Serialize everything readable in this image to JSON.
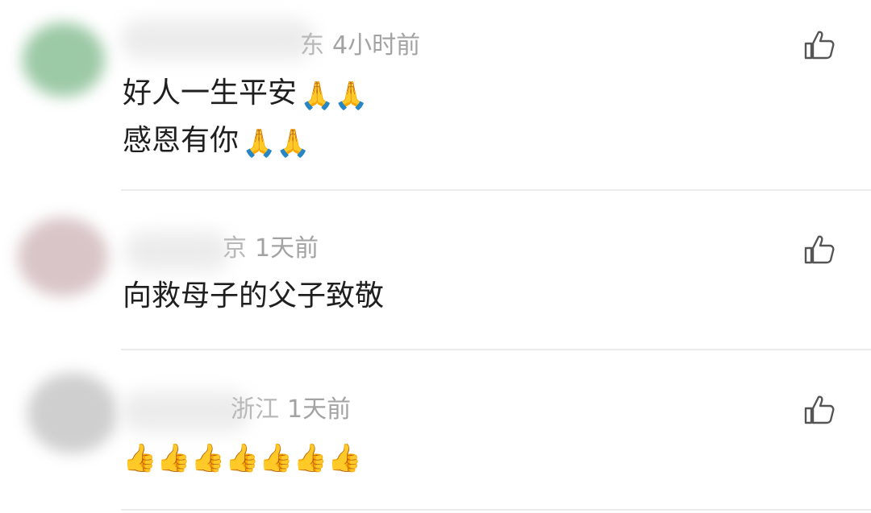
{
  "comments": [
    {
      "location": "东",
      "time": "4小时前",
      "lines": [
        {
          "text": "好人一生平安",
          "emoji": "🙏🙏"
        },
        {
          "text": "感恩有你",
          "emoji": "🙏🙏"
        }
      ],
      "like_icon": "thumbs-up-icon"
    },
    {
      "location": "京",
      "time": "1天前",
      "lines": [
        {
          "text": "向救母子的父子致敬",
          "emoji": ""
        }
      ],
      "like_icon": "thumbs-up-icon"
    },
    {
      "location": "浙江",
      "time": "1天前",
      "lines": [
        {
          "text": "",
          "emoji": "👍👍👍👍👍👍👍"
        }
      ],
      "like_icon": "thumbs-up-icon"
    }
  ]
}
